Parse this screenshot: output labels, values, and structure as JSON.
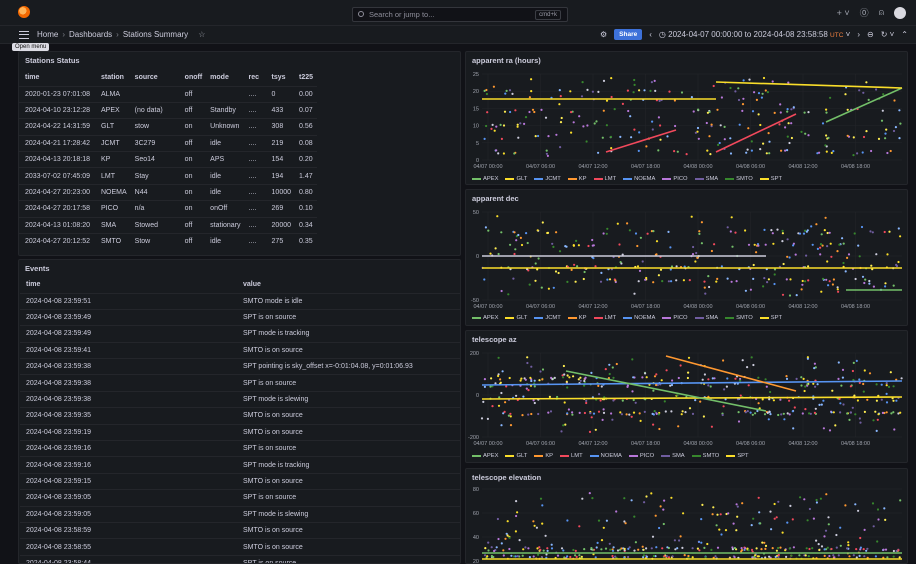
{
  "topbar": {
    "search_placeholder": "Search or jump to...",
    "search_shortcut": "cmd+k"
  },
  "nav": {
    "breadcrumbs": [
      "Home",
      "Dashboards",
      "Stations Summary"
    ],
    "tooltip": "Open menu"
  },
  "toolbar": {
    "share_label": "Share",
    "time_range": "2024-04-07 00:00:00 to 2024-04-08 23:58:58",
    "tz": "UTC"
  },
  "colors": {
    "APEX": "#73bf69",
    "GLT": "#fade2a",
    "JCMT": "#5794f2",
    "KP": "#ff9830",
    "LMT": "#f2495c",
    "NOEMA": "#5794f2",
    "PICO": "#b877d9",
    "SMA": "#705da0",
    "SMTO": "#37872d",
    "SPT": "#fade2a"
  },
  "stations_status": {
    "title": "Stations Status",
    "columns": [
      "time",
      "station",
      "source",
      "onoff",
      "mode",
      "rec",
      "tsys",
      "t225"
    ],
    "rows": [
      [
        "2020-01-23 07:01:08",
        "ALMA",
        "",
        "off",
        "",
        "....",
        "0",
        "0.00"
      ],
      [
        "2024-04-10 23:12:28",
        "APEX",
        "(no data)",
        "off",
        "Standby",
        "....",
        "433",
        "0.07"
      ],
      [
        "2024-04-22 14:31:59",
        "GLT",
        "stow",
        "on",
        "Unknown",
        "....",
        "308",
        "0.56"
      ],
      [
        "2024-04-21 17:28:42",
        "JCMT",
        "3C279",
        "off",
        "idle",
        "....",
        "219",
        "0.08"
      ],
      [
        "2024-04-13 20:18:18",
        "KP",
        "Seo14",
        "on",
        "APS",
        "....",
        "154",
        "0.20"
      ],
      [
        "2033-07-02 07:45:09",
        "LMT",
        "Stay",
        "on",
        "idle",
        "....",
        "194",
        "1.47"
      ],
      [
        "2024-04-27 20:23:00",
        "NOEMA",
        "N44",
        "on",
        "idle",
        "....",
        "10000",
        "0.80"
      ],
      [
        "2024-04-27 20:17:58",
        "PICO",
        "n/a",
        "on",
        "onOff",
        "....",
        "269",
        "0.10"
      ],
      [
        "2024-04-13 01:08:20",
        "SMA",
        "Stowed",
        "off",
        "stationary",
        "....",
        "20000",
        "0.34"
      ],
      [
        "2024-04-27 20:12:52",
        "SMTO",
        "Stow",
        "off",
        "idle",
        "....",
        "275",
        "0.35"
      ]
    ]
  },
  "events": {
    "title": "Events",
    "columns": [
      "time",
      "value"
    ],
    "rows": [
      [
        "2024-04-08 23:59:51",
        "SMTO mode is idle"
      ],
      [
        "2024-04-08 23:59:49",
        "SPT is on source"
      ],
      [
        "2024-04-08 23:59:49",
        "SPT mode is tracking"
      ],
      [
        "2024-04-08 23:59:41",
        "SMTO is on source"
      ],
      [
        "2024-04-08 23:59:38",
        "SPT pointing is sky_offset x=-0:01:04.08, y=0:01:06.93"
      ],
      [
        "2024-04-08 23:59:38",
        "SPT is on source"
      ],
      [
        "2024-04-08 23:59:38",
        "SPT mode is slewing"
      ],
      [
        "2024-04-08 23:59:35",
        "SMTO is on source"
      ],
      [
        "2024-04-08 23:59:19",
        "SMTO is on source"
      ],
      [
        "2024-04-08 23:59:16",
        "SPT is on source"
      ],
      [
        "2024-04-08 23:59:16",
        "SPT mode is tracking"
      ],
      [
        "2024-04-08 23:59:15",
        "SMTO is on source"
      ],
      [
        "2024-04-08 23:59:05",
        "SPT is on source"
      ],
      [
        "2024-04-08 23:59:05",
        "SPT mode is slewing"
      ],
      [
        "2024-04-08 23:58:59",
        "SMTO is on source"
      ],
      [
        "2024-04-08 23:58:55",
        "SMTO is on source"
      ],
      [
        "2024-04-08 23:58:44",
        "SPT is on source"
      ]
    ]
  },
  "chart_data": [
    {
      "type": "scatter",
      "title": "apparent ra (hours)",
      "ylim": [
        0,
        25
      ],
      "yticks": [
        "0",
        "5",
        "10",
        "15",
        "20",
        "25"
      ],
      "xticks": [
        "04/07 00:00",
        "04/07 06:00",
        "04/07 12:00",
        "04/07 18:00",
        "04/08 00:00",
        "04/08 06:00",
        "04/08 12:00",
        "04/08 18:00"
      ],
      "legend": [
        "APEX",
        "GLT",
        "JCMT",
        "KP",
        "LMT",
        "NOEMA",
        "PICO",
        "SMA",
        "SMTO",
        "SPT"
      ]
    },
    {
      "type": "scatter",
      "title": "apparent dec",
      "ylim": [
        -50,
        50
      ],
      "yticks": [
        "-50",
        "0",
        "50"
      ],
      "xticks": [
        "04/07 00:00",
        "04/07 06:00",
        "04/07 12:00",
        "04/07 18:00",
        "04/08 00:00",
        "04/08 06:00",
        "04/08 12:00",
        "04/08 18:00"
      ],
      "legend": [
        "APEX",
        "GLT",
        "JCMT",
        "KP",
        "LMT",
        "NOEMA",
        "PICO",
        "SMA",
        "SMTO",
        "SPT"
      ]
    },
    {
      "type": "scatter",
      "title": "telescope az",
      "ylim": [
        -200,
        200
      ],
      "yticks": [
        "-200",
        "0",
        "200"
      ],
      "xticks": [
        "04/07 00:00",
        "04/07 06:00",
        "04/07 12:00",
        "04/07 18:00",
        "04/08 00:00",
        "04/08 06:00",
        "04/08 12:00",
        "04/08 18:00"
      ],
      "legend": [
        "APEX",
        "GLT",
        "KP",
        "LMT",
        "NOEMA",
        "PICO",
        "SMA",
        "SMTO",
        "SPT"
      ]
    },
    {
      "type": "scatter",
      "title": "telescope elevation",
      "ylim": [
        0,
        80
      ],
      "yticks": [
        "20",
        "40",
        "60",
        "80"
      ],
      "xticks": [],
      "legend": []
    }
  ]
}
